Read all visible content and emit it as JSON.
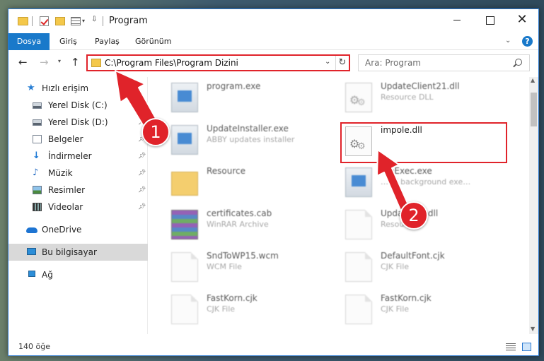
{
  "window": {
    "title": "Program",
    "controls": {
      "minimize": "",
      "maximize": "",
      "close": "✕"
    }
  },
  "ribbon": {
    "tabs": [
      {
        "label": "Dosya"
      },
      {
        "label": "Giriş"
      },
      {
        "label": "Paylaş"
      },
      {
        "label": "Görünüm"
      }
    ],
    "help": "?"
  },
  "navigation": {
    "address": "C:\\Program Files\\Program Dizini",
    "search_placeholder": "Ara: Program"
  },
  "sidebar": {
    "items": [
      {
        "label": "Hızlı erişim",
        "icon": "star-icon"
      },
      {
        "label": "Yerel Disk (C:)",
        "icon": "disk-icon"
      },
      {
        "label": "Yerel Disk (D:)",
        "icon": "disk-icon"
      },
      {
        "label": "Belgeler",
        "icon": "documents-icon"
      },
      {
        "label": "İndirmeler",
        "icon": "download-icon"
      },
      {
        "label": "Müzik",
        "icon": "music-icon"
      },
      {
        "label": "Resimler",
        "icon": "pictures-icon"
      },
      {
        "label": "Videolar",
        "icon": "videos-icon"
      },
      {
        "label": "OneDrive",
        "icon": "cloud-icon"
      },
      {
        "label": "Bu bilgisayar",
        "icon": "computer-icon",
        "selected": true
      },
      {
        "label": "Ağ",
        "icon": "network-icon"
      }
    ]
  },
  "files": [
    {
      "name": "program.exe",
      "type": ""
    },
    {
      "name": "UpdateClient21.dll",
      "type": "Resource DLL"
    },
    {
      "name": "UpdateInstaller.exe",
      "type": "ABBY updates installer"
    },
    {
      "name": "impole.dll",
      "type": ""
    },
    {
      "name": "Resource",
      "type": ""
    },
    {
      "name": "…eExec.exe",
      "type": "…BY background exe…"
    },
    {
      "name": "certificates.cab",
      "type": "WinRAR Archive"
    },
    {
      "name": "Update…5.dll",
      "type": "Resou…"
    },
    {
      "name": "SndToWP15.wcm",
      "type": "WCM File"
    },
    {
      "name": "DefaultFont.cjk",
      "type": "CJK File"
    },
    {
      "name": "FastKorn.cjk",
      "type": "CJK File"
    },
    {
      "name": "FastKorn.cjk",
      "type": "CJK File"
    }
  ],
  "status": {
    "count": "140 öğe"
  },
  "annotations": {
    "step1": "1",
    "step2": "2",
    "color": "#e0232a"
  }
}
